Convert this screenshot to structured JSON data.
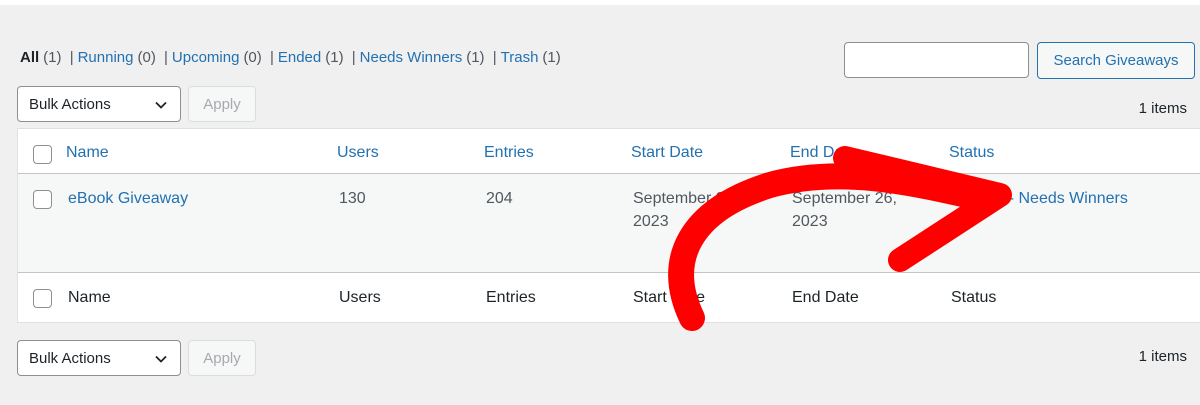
{
  "filters": [
    {
      "label": "All",
      "count": "(1)"
    },
    {
      "label": "Running",
      "count": "(0)"
    },
    {
      "label": "Upcoming",
      "count": "(0)"
    },
    {
      "label": "Ended",
      "count": "(1)"
    },
    {
      "label": "Needs Winners",
      "count": "(1)"
    },
    {
      "label": "Trash",
      "count": "(1)"
    }
  ],
  "separator": "|",
  "search": {
    "value": "",
    "button_label": "Search Giveaways"
  },
  "bulk": {
    "label": "Bulk Actions",
    "apply_label": "Apply"
  },
  "items_count": "1 items",
  "columns": {
    "head": [
      "Name",
      "Users",
      "Entries",
      "Start Date",
      "End Date",
      "Status"
    ],
    "foot": [
      "Name",
      "Users",
      "Entries",
      "Start Date",
      "End Date",
      "Status"
    ]
  },
  "rows": [
    {
      "name": "eBook Giveaway",
      "users": "130",
      "entries": "204",
      "start_date_line1": "September 23,",
      "start_date_line2": "2023",
      "end_date_line1": "September 26,",
      "end_date_line2": "2023",
      "status": "Ended - Needs Winners"
    }
  ],
  "colors": {
    "accent": "#2271b1",
    "arrow": "#ff0000"
  }
}
